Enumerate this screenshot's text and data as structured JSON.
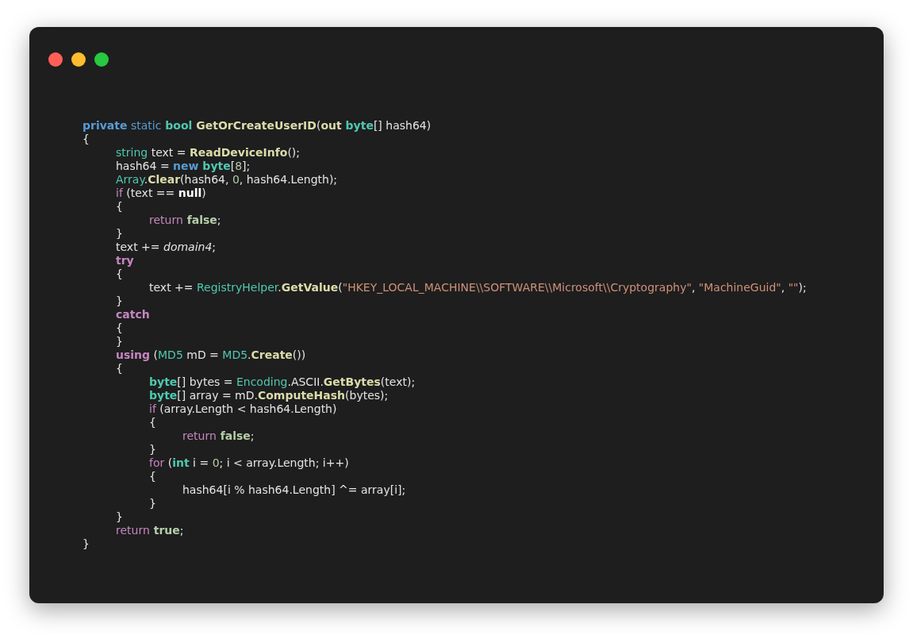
{
  "window": {
    "controls": [
      {
        "color": "#ff5f57"
      },
      {
        "color": "#febc2e"
      },
      {
        "color": "#28c840"
      }
    ]
  },
  "code": {
    "lines": [
      [
        {
          "kind": "kwb",
          "text": "private"
        },
        {
          "kind": "kw",
          "text": " static"
        },
        {
          "kind": "typeb",
          "text": " bool"
        },
        {
          "kind": "fn",
          "text": " GetOrCreateUserID"
        },
        {
          "kind": "p",
          "text": "("
        },
        {
          "kind": "fn",
          "text": "out"
        },
        {
          "kind": "typeb",
          "text": " byte"
        },
        {
          "kind": "p",
          "text": "[] hash64)"
        }
      ],
      [
        {
          "kind": "p",
          "text": "{"
        }
      ],
      [
        {
          "kind": "type",
          "text": "\tstring"
        },
        {
          "kind": "p",
          "text": " text = "
        },
        {
          "kind": "fn",
          "text": "ReadDeviceInfo"
        },
        {
          "kind": "p",
          "text": "();"
        }
      ],
      [
        {
          "kind": "p",
          "text": "\thash64 = "
        },
        {
          "kind": "kwb",
          "text": "new"
        },
        {
          "kind": "typeb",
          "text": " byte"
        },
        {
          "kind": "p",
          "text": "["
        },
        {
          "kind": "num",
          "text": "8"
        },
        {
          "kind": "p",
          "text": "];"
        }
      ],
      [
        {
          "kind": "type",
          "text": "\tArray"
        },
        {
          "kind": "p",
          "text": "."
        },
        {
          "kind": "fn",
          "text": "Clear"
        },
        {
          "kind": "p",
          "text": "(hash64, "
        },
        {
          "kind": "num",
          "text": "0"
        },
        {
          "kind": "p",
          "text": ", hash64.Length);"
        }
      ],
      [
        {
          "kind": "ctl",
          "text": "\tif"
        },
        {
          "kind": "p",
          "text": " (text == "
        },
        {
          "kind": "pb",
          "text": "null"
        },
        {
          "kind": "p",
          "text": ")"
        }
      ],
      [
        {
          "kind": "p",
          "text": "\t{"
        }
      ],
      [
        {
          "kind": "ctl",
          "text": "\t\treturn"
        },
        {
          "kind": "lit",
          "text": " false"
        },
        {
          "kind": "p",
          "text": ";"
        }
      ],
      [
        {
          "kind": "p",
          "text": "\t}"
        }
      ],
      [
        {
          "kind": "p",
          "text": "\ttext += "
        },
        {
          "kind": "it",
          "text": "domain4"
        },
        {
          "kind": "p",
          "text": ";"
        }
      ],
      [
        {
          "kind": "ctlb",
          "text": "\ttry"
        }
      ],
      [
        {
          "kind": "p",
          "text": "\t{"
        }
      ],
      [
        {
          "kind": "p",
          "text": "\t\ttext += "
        },
        {
          "kind": "type",
          "text": "RegistryHelper"
        },
        {
          "kind": "p",
          "text": "."
        },
        {
          "kind": "fn",
          "text": "GetValue"
        },
        {
          "kind": "p",
          "text": "("
        },
        {
          "kind": "str",
          "text": "\"HKEY_LOCAL_MACHINE\\\\SOFTWARE\\\\Microsoft\\\\Cryptography\""
        },
        {
          "kind": "p",
          "text": ", "
        },
        {
          "kind": "str",
          "text": "\"MachineGuid\""
        },
        {
          "kind": "p",
          "text": ", "
        },
        {
          "kind": "str",
          "text": "\"\""
        },
        {
          "kind": "p",
          "text": ");"
        }
      ],
      [
        {
          "kind": "p",
          "text": "\t}"
        }
      ],
      [
        {
          "kind": "ctlb",
          "text": "\tcatch"
        }
      ],
      [
        {
          "kind": "p",
          "text": "\t{"
        }
      ],
      [
        {
          "kind": "p",
          "text": "\t}"
        }
      ],
      [
        {
          "kind": "ctlb",
          "text": "\tusing"
        },
        {
          "kind": "p",
          "text": " ("
        },
        {
          "kind": "type",
          "text": "MD5"
        },
        {
          "kind": "p",
          "text": " mD = "
        },
        {
          "kind": "type",
          "text": "MD5"
        },
        {
          "kind": "p",
          "text": "."
        },
        {
          "kind": "fn",
          "text": "Create"
        },
        {
          "kind": "p",
          "text": "())"
        }
      ],
      [
        {
          "kind": "p",
          "text": "\t{"
        }
      ],
      [
        {
          "kind": "typeb",
          "text": "\t\tbyte"
        },
        {
          "kind": "p",
          "text": "[] bytes = "
        },
        {
          "kind": "type",
          "text": "Encoding"
        },
        {
          "kind": "p",
          "text": ".ASCII."
        },
        {
          "kind": "fn",
          "text": "GetBytes"
        },
        {
          "kind": "p",
          "text": "(text);"
        }
      ],
      [
        {
          "kind": "typeb",
          "text": "\t\tbyte"
        },
        {
          "kind": "p",
          "text": "[] array = mD."
        },
        {
          "kind": "fn",
          "text": "ComputeHash"
        },
        {
          "kind": "p",
          "text": "(bytes);"
        }
      ],
      [
        {
          "kind": "ctl",
          "text": "\t\tif"
        },
        {
          "kind": "p",
          "text": " (array.Length < hash64.Length)"
        }
      ],
      [
        {
          "kind": "p",
          "text": "\t\t{"
        }
      ],
      [
        {
          "kind": "ctl",
          "text": "\t\t\treturn"
        },
        {
          "kind": "lit",
          "text": " false"
        },
        {
          "kind": "p",
          "text": ";"
        }
      ],
      [
        {
          "kind": "p",
          "text": "\t\t}"
        }
      ],
      [
        {
          "kind": "ctl",
          "text": "\t\tfor"
        },
        {
          "kind": "p",
          "text": " ("
        },
        {
          "kind": "typeb",
          "text": "int"
        },
        {
          "kind": "p",
          "text": " i = "
        },
        {
          "kind": "num",
          "text": "0"
        },
        {
          "kind": "p",
          "text": "; i < array.Length; i++)"
        }
      ],
      [
        {
          "kind": "p",
          "text": "\t\t{"
        }
      ],
      [
        {
          "kind": "p",
          "text": "\t\t\thash64[i % hash64.Length] ^= array[i];"
        }
      ],
      [
        {
          "kind": "p",
          "text": "\t\t}"
        }
      ],
      [
        {
          "kind": "p",
          "text": "\t}"
        }
      ],
      [
        {
          "kind": "ctl",
          "text": "\treturn"
        },
        {
          "kind": "lit",
          "text": " true"
        },
        {
          "kind": "p",
          "text": ";"
        }
      ],
      [
        {
          "kind": "p",
          "text": "}"
        }
      ]
    ]
  }
}
